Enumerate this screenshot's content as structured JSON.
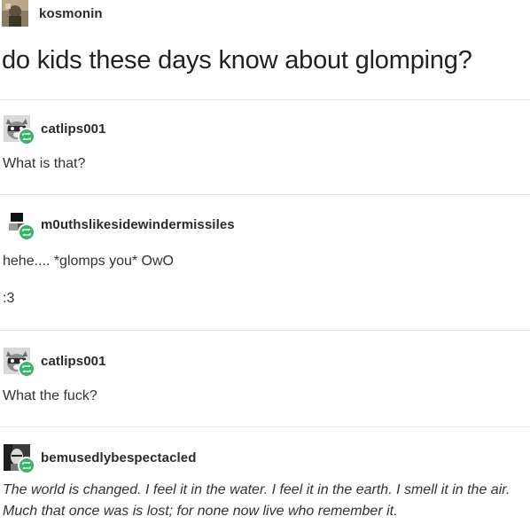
{
  "op": {
    "username": "kosmonin",
    "title": "do kids these days know about glomping?"
  },
  "replies": [
    {
      "username": "catlips001",
      "lines": [
        "What is that?"
      ]
    },
    {
      "username": "m0uthslikesidewindermissiles",
      "lines": [
        "hehe.... *glomps you* OwO",
        ":3"
      ]
    },
    {
      "username": "catlips001",
      "lines": [
        "What the fuck?"
      ]
    },
    {
      "username": "bemusedlybespectacled",
      "lines": [
        "The world is changed. I feel it in the water. I feel it in the earth. I smell it in the air. Much that once was is lost; for none now live who remember it."
      ]
    }
  ],
  "colors": {
    "reblog_badge": "#3ab26a",
    "divider": "#e2e2e2"
  }
}
